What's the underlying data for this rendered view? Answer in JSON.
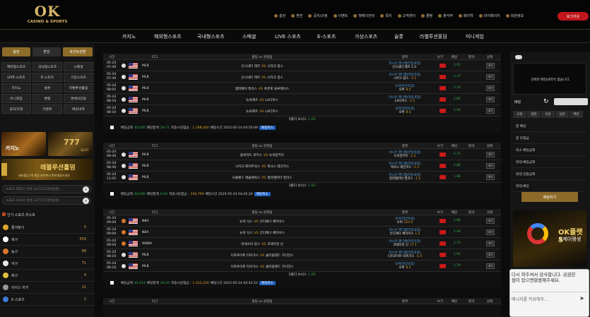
{
  "brand": {
    "logo": "OK",
    "subtitle": "CASINO & SPORTS"
  },
  "topmenu": [
    "충전",
    "환전",
    "공지/규정",
    "이벤트",
    "명예의전당",
    "쪽지",
    "고객센터",
    "쿨짱",
    "출석부",
    "페이백",
    "마이페이지",
    "회원정보"
  ],
  "logout": "로그아웃",
  "nav": [
    "카지노",
    "해외형스포츠",
    "국내형스포츠",
    "스페셜",
    "LIVE 스포츠",
    "E-스포츠",
    "가상스포츠",
    "슬롯",
    "라벨루션홀덤",
    "미니게임"
  ],
  "left": {
    "btns": [
      "충전",
      "환전",
      "포인트전환"
    ],
    "grid": [
      "해외형스포츠",
      "국내형스포츠",
      "스페셜",
      "LIVE-스포츠",
      "E-스포츠",
      "가상스포츠",
      "카지노",
      "슬롯",
      "라벨루션홀덤",
      "미니게임",
      "쿨짱",
      "명예의전당",
      "공지/규정",
      "이벤트",
      "배팅내역"
    ],
    "promo1": "카지노",
    "promo2": "SLOT",
    "promo3": "레볼루션홀덤",
    "promo3_sub": "대표홀덤 VS 밸류 화면에서 편하게즐기세요",
    "search1": "스포츠 해외식 검색 (국가/리그명/팀명)",
    "search2": "스포츠 국내식 검색 (국가/리그명/팀명)",
    "popular": "인기 스포츠 리스트",
    "sports": [
      {
        "name": "즐겨찾기",
        "count": "0",
        "color": "#e0a32a"
      },
      {
        "name": "축구",
        "count": "550",
        "color": "#ffffff"
      },
      {
        "name": "농구",
        "count": "88",
        "color": "#d9752c"
      },
      {
        "name": "야구",
        "count": "71",
        "color": "#e8e8e8"
      },
      {
        "name": "배구",
        "count": "4",
        "color": "#e2c13e"
      },
      {
        "name": "아이스 하키",
        "count": "11",
        "color": "#999999"
      },
      {
        "name": "E-스포츠",
        "count": "2",
        "color": "#3c7bd6"
      }
    ]
  },
  "table_headers": [
    "시간",
    "리그",
    "홈팀 vs 원정팀",
    "항목",
    "보기",
    "배당",
    "결과",
    "상태"
  ],
  "sections": [
    {
      "rows": [
        {
          "date": "05-24",
          "time": "07:40",
          "league": "MLB",
          "home": "신시내티 레즈",
          "away": "시카고 컵스",
          "o1": "아시안 핸디캡(연장포함)",
          "o2": "신시내티 레즈 1.5",
          "o3": "",
          "odds": "2.01",
          "state": "대기",
          "ball": "baseball"
        },
        {
          "date": "05-24",
          "time": "07:40",
          "league": "MLB",
          "home": "신시내티 레즈",
          "away": "시카고 컵스",
          "o1": "아시안 핸디캡(연장포함)",
          "o2": "시카고 컵스",
          "o3": "-1.5",
          "odds": "2.37",
          "state": "대기",
          "ball": "baseball"
        },
        {
          "date": "05-24",
          "time": "08:05",
          "league": "MLB",
          "home": "템파베이 레이스",
          "away": "토론토 블루제이스",
          "o1": "오버(연장포함)",
          "o2": "오버",
          "o3": "8.5",
          "odds": "2.32",
          "state": "대기",
          "ball": "baseball"
        },
        {
          "date": "05-24",
          "time": "08:10",
          "league": "MLB",
          "home": "뉴욕메츠",
          "away": "LA다저스",
          "o1": "아시안 핸디캡(연장포함)",
          "o2": "LA다저스",
          "o3": "-1.5",
          "odds": "1.82",
          "state": "대기",
          "ball": "baseball"
        },
        {
          "date": "05-24",
          "time": "08:10",
          "league": "MLB",
          "home": "뉴욕메츠",
          "away": "LA다저스",
          "o1": "오버(연장포함)",
          "o2": "오버",
          "o3": "8.5",
          "odds": "1.54",
          "state": "대기",
          "ball": "baseball"
        }
      ],
      "bonus": "5폴더 보너스",
      "bonus_val": "1.05",
      "sum": {
        "a": "배팅금액",
        "av": "40,000",
        "b": "배당합계",
        "bv": "29.71",
        "c": "적중시당첨금 :",
        "cv": "1,188,400",
        "d": "배팅시간 2025-05-24 04:50:09"
      }
    },
    {
      "rows": [
        {
          "date": "05-24",
          "time": "09:40",
          "league": "MLB",
          "home": "콜로라도 로키스",
          "away": "뉴욕양키즈",
          "o1": "아시안 핸디캡(연장포함)",
          "o2": "뉴욕양키즈",
          "o3": "-2.5",
          "odds": "1.71",
          "state": "대기",
          "ball": "baseball"
        },
        {
          "date": "05-24",
          "time": "08:40",
          "league": "MLB",
          "home": "시카고 화이트삭스",
          "away": "텍사스 레인저스",
          "o1": "아시안 핸디캡(연장포함)",
          "o2": "텍사스 레인저스",
          "o3": "-1.5",
          "odds": "1.86",
          "state": "대기",
          "ball": "baseball"
        },
        {
          "date": "05-24",
          "time": "11:05",
          "league": "MLB",
          "home": "오클랜드 애슬레틱스",
          "away": "필라델피아 필리스",
          "o1": "아시안 핸디캡(연장포함)",
          "o2": "필라델피아 필리스",
          "o3": "-1.5",
          "odds": "1.84",
          "state": "대기",
          "ball": "baseball"
        }
      ],
      "bonus": "3폴더 보너스",
      "bonus_val": "1.03",
      "sum": {
        "a": "배팅금액",
        "av": "40,000",
        "b": "배당합계",
        "bv": "6.00",
        "c": "적중시당첨금 :",
        "cv": "240,799",
        "d": "배팅시간 2025-05-24 04:45:26"
      }
    },
    {
      "rows": [
        {
          "date": "05-24",
          "time": "09:00",
          "league": "NBA",
          "home": "뉴욕 닉스",
          "away": "인디애나 페이서스",
          "o1": "오버(연장포함)",
          "o2": "오버",
          "o3": "224.5",
          "odds": "1.86",
          "state": "대기",
          "ball": "basketball"
        },
        {
          "date": "05-24",
          "time": "09:00",
          "league": "NBA",
          "home": "뉴욕 닉스",
          "away": "인디애나 페이서스",
          "o1": "아시안 핸디캡(연장포함)",
          "o2": "인디애나 페이서스",
          "o3": "1.5",
          "odds": "1.94",
          "state": "대기",
          "ball": "basketball"
        },
        {
          "date": "05-24",
          "time": "09:00",
          "league": "WNBA",
          "home": "미네소타 링스",
          "away": "코네티컷 선",
          "o1": "아시안 핸디캡(연장포함)",
          "o2": "코네티컷 선",
          "o3": "17.5",
          "odds": "1.71",
          "state": "대기",
          "ball": "basketball"
        },
        {
          "date": "05-24",
          "time": "08:10",
          "league": "MLB",
          "home": "디트로이트 타이거스",
          "away": "클리블랜드 가디언스",
          "o1": "아시안 핸디캡(연장포함)",
          "o2": "디트로이트 타이거스",
          "o3": "-1.5",
          "odds": "1.91",
          "state": "대기",
          "ball": "baseball"
        },
        {
          "date": "05-24",
          "time": "08:10",
          "league": "MLB",
          "home": "디트로이트 타이거스",
          "away": "클리블랜드 가디언스",
          "o1": "오버(연장포함)",
          "o2": "오버",
          "o3": "8.5",
          "odds": "1.79",
          "state": "대기",
          "ball": "baseball"
        }
      ],
      "bonus": "5폴더 보너스",
      "bonus_val": "1.05",
      "sum": {
        "a": "배팅금액",
        "av": "45,619",
        "b": "배당합계",
        "bv": "29.20",
        "c": "적중시당첨금 :",
        "cv": "1,333,250",
        "d": "배팅시간 2025-05-24 04:42:22"
      }
    }
  ],
  "cancel": "배팅취소",
  "vs": "VS",
  "right": {
    "empty": "선택된 배팅내역이 없습니다.",
    "bet_label": "배팅",
    "tabs": [
      "오천",
      "일만",
      "오만",
      "십만",
      "백만"
    ],
    "lines": [
      {
        "label": "총 배당",
        "value": ""
      },
      {
        "label": "총 당첨금",
        "value": ""
      },
      {
        "label": "최소 배팅금액",
        "value": ""
      },
      {
        "label": "최대 배팅금액",
        "value": ""
      },
      {
        "label": "최대 당첨금액",
        "value": ""
      },
      {
        "label": "최대 배당",
        "value": ""
      }
    ],
    "bet_btn": "배팅하기",
    "promo_title": "OK플랫5",
    "promo_sub": "오케이평생"
  },
  "chat": {
    "msg1": "다시 와주셔서 감사합니다. 궁금한",
    "msg2": "점이 있으면말씀해주세요.",
    "placeholder": "메시지를 작성해주...",
    "send": "➤"
  }
}
